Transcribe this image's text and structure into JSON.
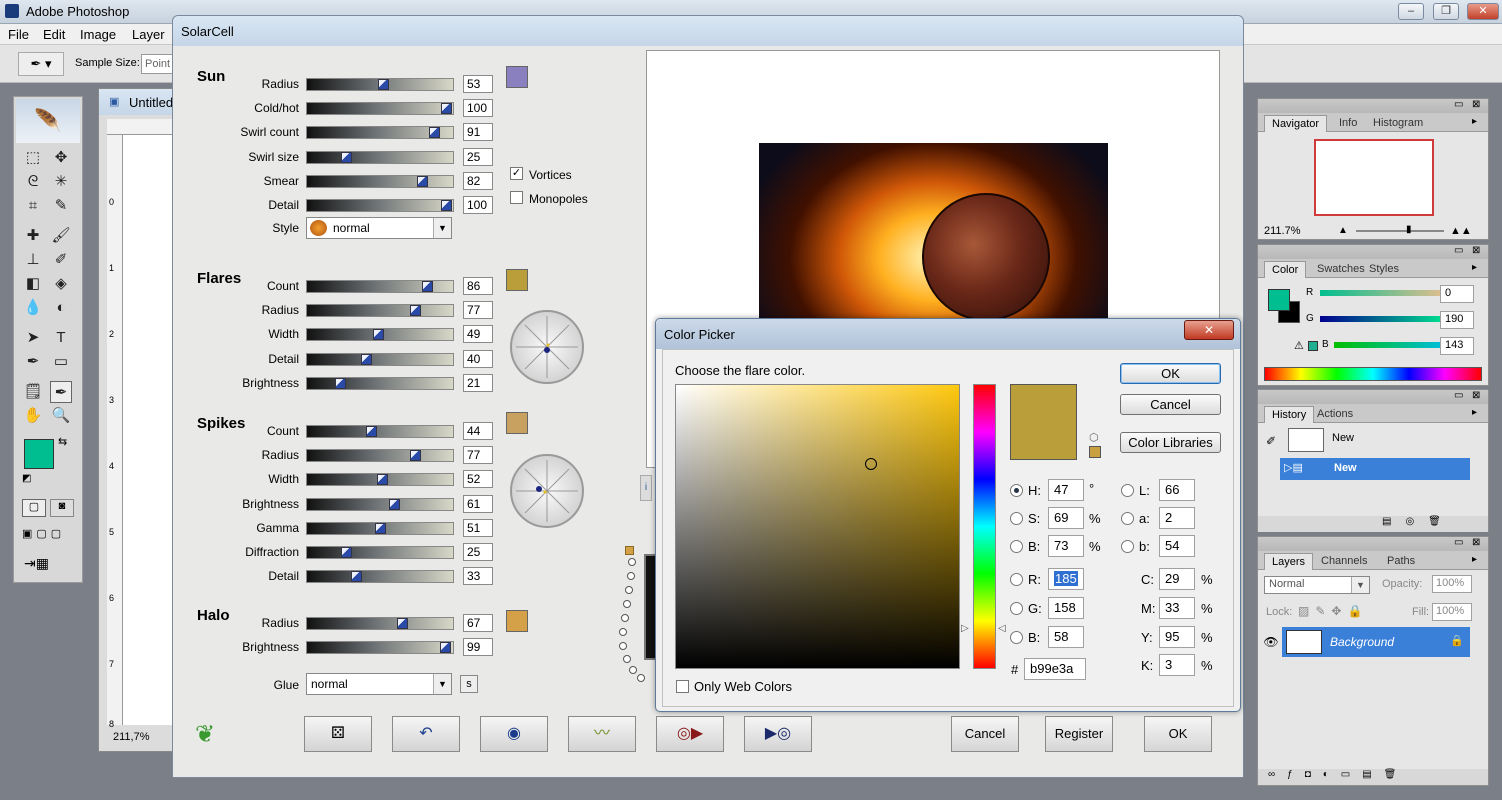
{
  "app": {
    "title": "Adobe Photoshop",
    "menu": [
      "File",
      "Edit",
      "Image",
      "Layer"
    ]
  },
  "options_bar": {
    "sample_size_label": "Sample Size:",
    "sample_size_value": "Point"
  },
  "document": {
    "title": "Untitled",
    "zoom": "211,7%"
  },
  "solarcell": {
    "title": "SolarCell",
    "sun": {
      "heading": "Sun",
      "params": [
        {
          "label": "Radius",
          "value": "53",
          "pos": 0.53
        },
        {
          "label": "Cold/hot",
          "value": "100",
          "pos": 1.0
        },
        {
          "label": "Swirl count",
          "value": "91",
          "pos": 0.91
        },
        {
          "label": "Swirl size",
          "value": "25",
          "pos": 0.25
        },
        {
          "label": "Smear",
          "value": "82",
          "pos": 0.82
        },
        {
          "label": "Detail",
          "value": "100",
          "pos": 1.0
        }
      ],
      "swatch_color": "#8a80c0",
      "vortices_label": "Vortices",
      "vortices_checked": true,
      "monopoles_label": "Monopoles",
      "monopoles_checked": false,
      "style_label": "Style",
      "style_value": "normal"
    },
    "flares": {
      "heading": "Flares",
      "params": [
        {
          "label": "Count",
          "value": "86",
          "pos": 0.86
        },
        {
          "label": "Radius",
          "value": "77",
          "pos": 0.77
        },
        {
          "label": "Width",
          "value": "49",
          "pos": 0.49
        },
        {
          "label": "Detail",
          "value": "40",
          "pos": 0.4
        },
        {
          "label": "Brightness",
          "value": "21",
          "pos": 0.21
        }
      ],
      "swatch_color": "#b99e3a"
    },
    "spikes": {
      "heading": "Spikes",
      "params": [
        {
          "label": "Count",
          "value": "44",
          "pos": 0.44
        },
        {
          "label": "Radius",
          "value": "77",
          "pos": 0.77
        },
        {
          "label": "Width",
          "value": "52",
          "pos": 0.52
        },
        {
          "label": "Brightness",
          "value": "61",
          "pos": 0.61
        },
        {
          "label": "Gamma",
          "value": "51",
          "pos": 0.51
        },
        {
          "label": "Diffraction",
          "value": "25",
          "pos": 0.25
        },
        {
          "label": "Detail",
          "value": "33",
          "pos": 0.33
        }
      ],
      "swatch_color": "#c8a060"
    },
    "halo": {
      "heading": "Halo",
      "params": [
        {
          "label": "Radius",
          "value": "67",
          "pos": 0.67
        },
        {
          "label": "Brightness",
          "value": "99",
          "pos": 0.99
        }
      ],
      "swatch_color": "#d4a048"
    },
    "glue_label": "Glue",
    "glue_value": "normal",
    "glue_s": "s",
    "buttons": {
      "cancel": "Cancel",
      "register": "Register",
      "ok": "OK"
    }
  },
  "color_picker": {
    "title": "Color Picker",
    "prompt": "Choose the flare color.",
    "ok": "OK",
    "cancel": "Cancel",
    "libraries": "Color Libraries",
    "fields": {
      "H": "47",
      "S": "69",
      "B": "73",
      "R": "185",
      "G": "158",
      "Bl": "58",
      "L": "66",
      "a": "2",
      "b": "54",
      "C": "29",
      "M": "33",
      "Y": "95",
      "K": "3"
    },
    "labels": {
      "H": "H:",
      "S": "S:",
      "B": "B:",
      "R": "R:",
      "G": "G:",
      "Bl": "B:",
      "L": "L:",
      "a": "a:",
      "b": "b:",
      "C": "C:",
      "M": "M:",
      "Y": "Y:",
      "K": "K:",
      "deg": "°",
      "pct": "%",
      "hash": "#"
    },
    "hex": "b99e3a",
    "only_web_colors": "Only Web Colors",
    "current_color": "#b99e3a"
  },
  "navigator": {
    "tabs": [
      "Navigator",
      "Info",
      "Histogram"
    ],
    "zoom": "211.7%"
  },
  "color_panel": {
    "tabs": [
      "Color",
      "Swatches",
      "Styles"
    ],
    "R_label": "R",
    "G_label": "G",
    "B_label": "B",
    "R": "0",
    "G": "190",
    "B": "143",
    "fg": "#00be8f"
  },
  "history": {
    "tabs": [
      "History",
      "Actions"
    ],
    "snapshot": "New",
    "state": "New"
  },
  "layers": {
    "tabs": [
      "Layers",
      "Channels",
      "Paths"
    ],
    "blend": "Normal",
    "opacity_label": "Opacity:",
    "opacity": "100%",
    "lock_label": "Lock:",
    "fill_label": "Fill:",
    "fill": "100%",
    "layer": "Background"
  }
}
